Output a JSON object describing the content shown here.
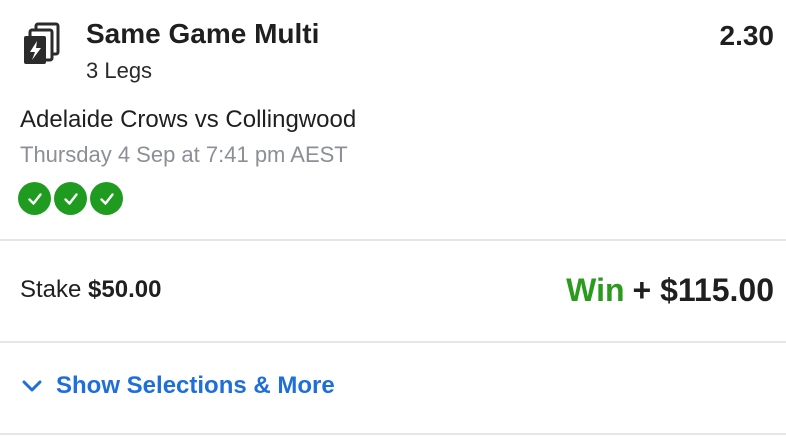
{
  "bet": {
    "type_title": "Same Game Multi",
    "legs_label": "3 Legs",
    "odds": "2.30",
    "icon": "same-game-multi-icon"
  },
  "event": {
    "match": "Adelaide Crows vs Collingwood",
    "datetime": "Thursday 4 Sep at 7:41 pm AEST"
  },
  "legs_status": [
    {
      "status": "won",
      "icon": "check-icon"
    },
    {
      "status": "won",
      "icon": "check-icon"
    },
    {
      "status": "won",
      "icon": "check-icon"
    }
  ],
  "stake": {
    "label": "Stake",
    "amount": "$50.00"
  },
  "win": {
    "label": "Win",
    "amount": "+ $115.00"
  },
  "actions": {
    "show_more": "Show Selections & More"
  },
  "colors": {
    "win_green": "#2a9b1e",
    "check_green": "#1f9c1f",
    "link_blue": "#1e6fd9",
    "muted_gray": "#8c8f96"
  }
}
